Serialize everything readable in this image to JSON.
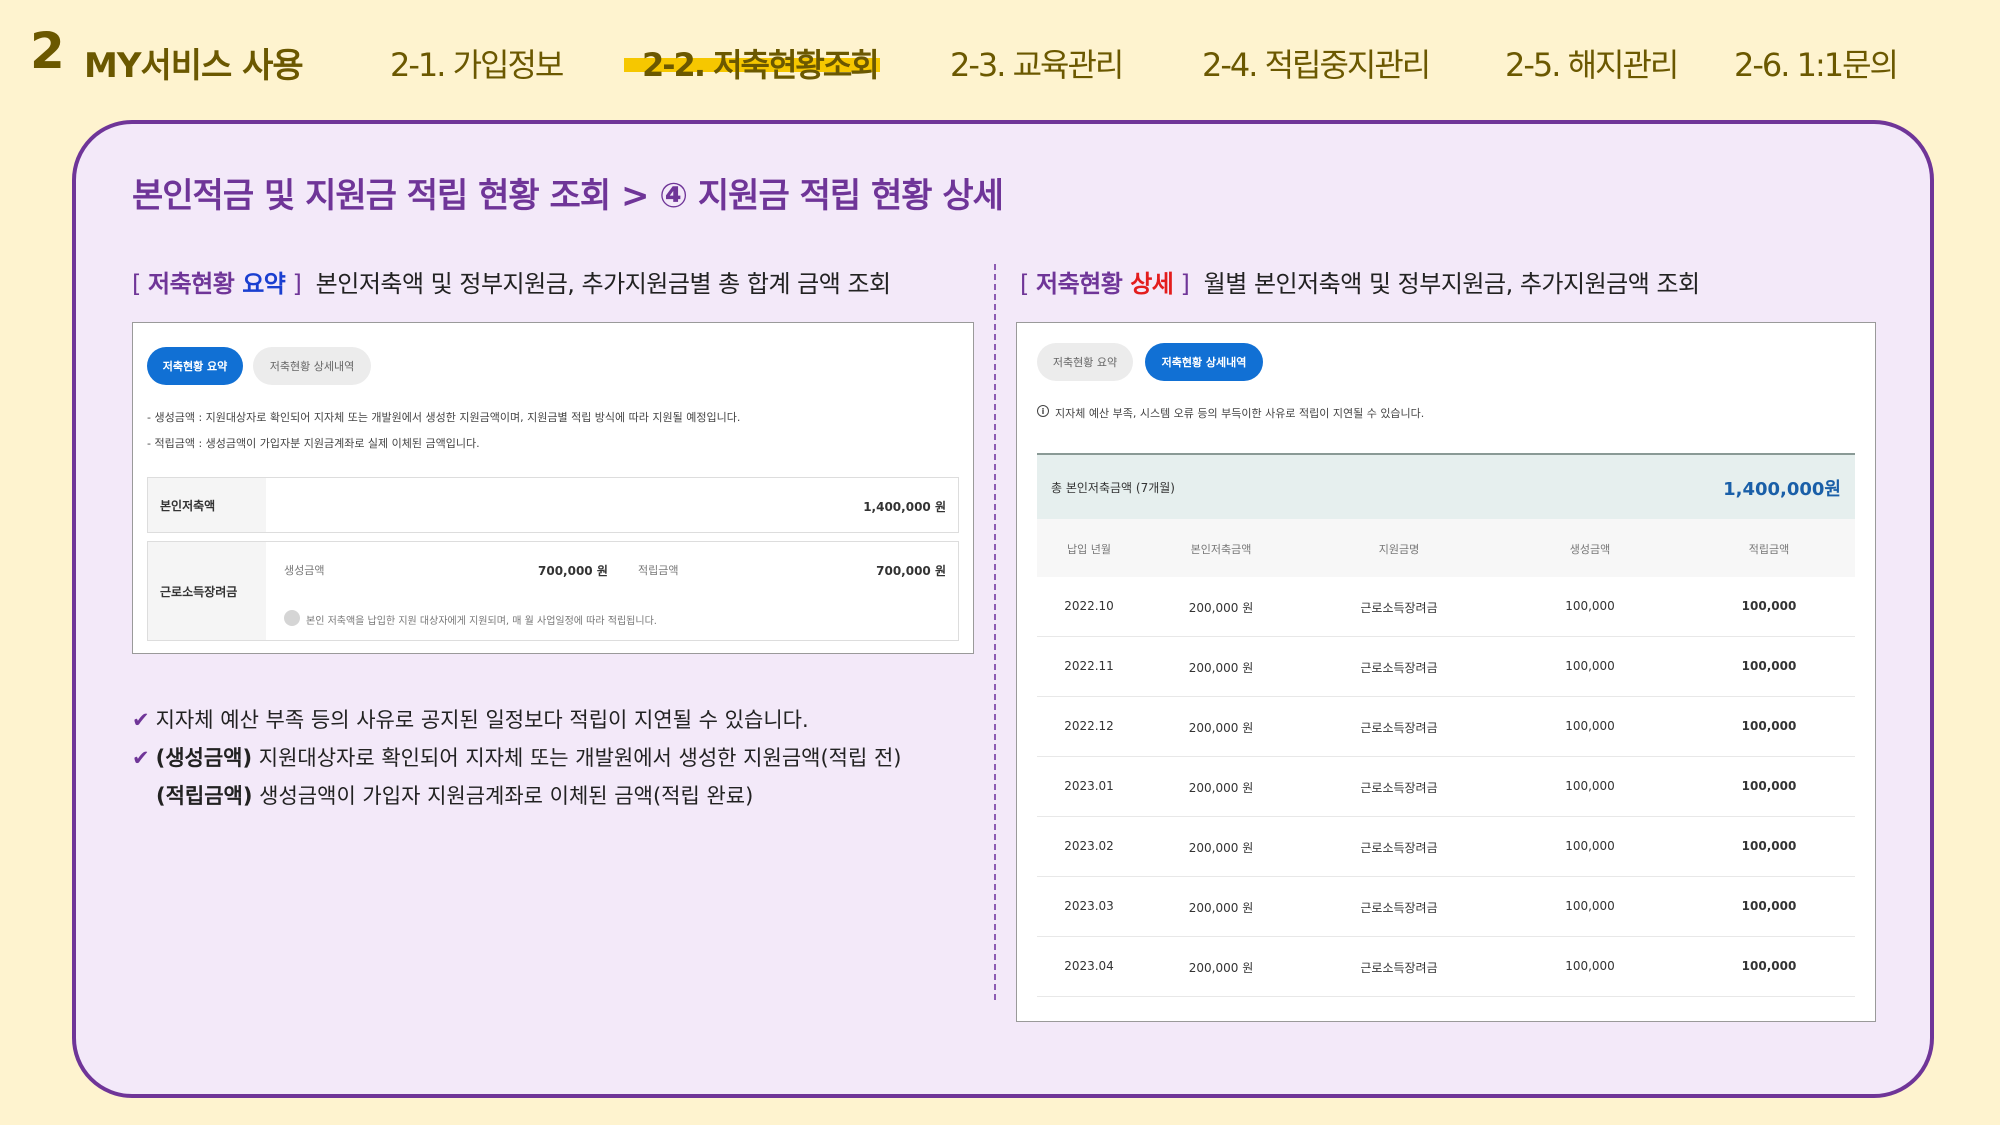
{
  "nav": {
    "section_number": "2",
    "section_title": "MY서비스 사용",
    "tabs": [
      {
        "label": "2-1. 가입정보",
        "active": false
      },
      {
        "label": "2-2. 저축현황조회",
        "active": true
      },
      {
        "label": "2-3. 교육관리",
        "active": false
      },
      {
        "label": "2-4. 적립중지관리",
        "active": false
      },
      {
        "label": "2-5. 해지관리",
        "active": false
      },
      {
        "label": "2-6. 1:1문의",
        "active": false
      }
    ],
    "active_underline_color": "#f6c700"
  },
  "panel": {
    "heading": "본인적금 및 지원금 적립 현황 조회 > ④ 지원금 적립 현황 상세",
    "border_color": "#6f3598"
  },
  "summary_section": {
    "bracket_open": "[",
    "title_plain": "저축현황 ",
    "title_key": "요약",
    "bracket_close": "]",
    "description": "본인저축액 및 정부지원금, 추가지원금별 총 합계 금액 조회",
    "tabs": [
      "저축현황 요약",
      "저축현황 상세내역"
    ],
    "notes": [
      "-   생성금액 : 지원대상자로 확인되어 지자체 또는 개발원에서 생성한 지원금액이며, 지원금별 적립 방식에 따라 지원될 예정입니다.",
      "-   적립금액 : 생성금액이 가입자분 지원금계좌로 실제 이체된 금액입니다."
    ],
    "own_savings": {
      "label": "본인저축액",
      "amount": "1,400,000 원"
    },
    "incentive": {
      "label": "근로소득장려금",
      "created_label": "생성금액",
      "created_amount": "700,000 원",
      "deposited_label": "적립금액",
      "deposited_amount": "700,000 원",
      "note": "본인 저축액을 납입한 지원 대상자에게 지원되며, 매 월 사업일정에 따라 적립됩니다."
    }
  },
  "detail_section": {
    "bracket_open": "[",
    "title_plain": "저축현황 ",
    "title_key": "상세",
    "bracket_close": "]",
    "description": "월별 본인저축액 및 정부지원금, 추가지원금액 조회",
    "tabs": [
      "저축현황 요약",
      "저축현황 상세내역"
    ],
    "info": "지자체 예산 부족, 시스템 오류 등의 부득이한 사유로 적립이 지연될 수 있습니다.",
    "total_label": "총 본인저축금액 (7개월)",
    "total_value": "1,400,000원",
    "columns": [
      "납입 년월",
      "본인저축금액",
      "지원금명",
      "생성금액",
      "적립금액"
    ],
    "rows": [
      [
        "2022.10",
        "200,000 원",
        "근로소득장려금",
        "100,000",
        "100,000"
      ],
      [
        "2022.11",
        "200,000 원",
        "근로소득장려금",
        "100,000",
        "100,000"
      ],
      [
        "2022.12",
        "200,000 원",
        "근로소득장려금",
        "100,000",
        "100,000"
      ],
      [
        "2023.01",
        "200,000 원",
        "근로소득장려금",
        "100,000",
        "100,000"
      ],
      [
        "2023.02",
        "200,000 원",
        "근로소득장려금",
        "100,000",
        "100,000"
      ],
      [
        "2023.03",
        "200,000 원",
        "근로소득장려금",
        "100,000",
        "100,000"
      ],
      [
        "2023.04",
        "200,000 원",
        "근로소득장려금",
        "100,000",
        "100,000"
      ]
    ]
  },
  "checklist": [
    {
      "mark": "✔",
      "term": "",
      "text": "지자체 예산 부족 등의 사유로 공지된 일정보다 적립이 지연될 수 있습니다."
    },
    {
      "mark": "✔",
      "term": "(생성금액)",
      "text": " 지원대상자로 확인되어 지자체 또는 개발원에서 생성한 지원금액(적립 전)"
    },
    {
      "mark": "",
      "term": "(적립금액)",
      "text": " 생성금액이 가입자 지원금계좌로 이체된 금액(적립 완료)"
    }
  ]
}
